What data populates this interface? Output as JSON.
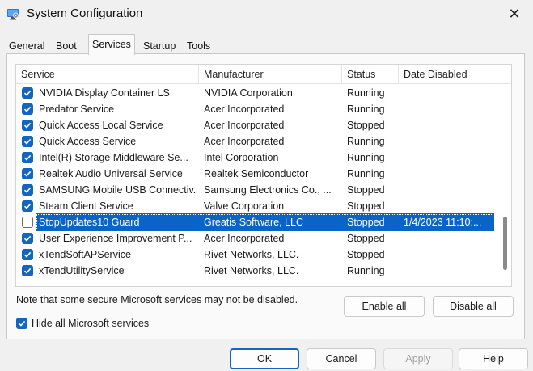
{
  "window": {
    "title": "System Configuration",
    "close_glyph": "✕"
  },
  "tabs": [
    {
      "label": "General"
    },
    {
      "label": "Boot"
    },
    {
      "label": "Services",
      "active": true
    },
    {
      "label": "Startup"
    },
    {
      "label": "Tools"
    }
  ],
  "services_list": {
    "columns": [
      "Service",
      "Manufacturer",
      "Status",
      "Date Disabled"
    ],
    "rows": [
      {
        "checked": true,
        "service": "NVIDIA Display Container LS",
        "manufacturer": "NVIDIA Corporation",
        "status": "Running",
        "date_disabled": ""
      },
      {
        "checked": true,
        "service": "Predator Service",
        "manufacturer": "Acer Incorporated",
        "status": "Running",
        "date_disabled": ""
      },
      {
        "checked": true,
        "service": "Quick Access Local Service",
        "manufacturer": "Acer Incorporated",
        "status": "Stopped",
        "date_disabled": ""
      },
      {
        "checked": true,
        "service": "Quick Access Service",
        "manufacturer": "Acer Incorporated",
        "status": "Running",
        "date_disabled": ""
      },
      {
        "checked": true,
        "service": "Intel(R) Storage Middleware Se...",
        "manufacturer": "Intel Corporation",
        "status": "Running",
        "date_disabled": ""
      },
      {
        "checked": true,
        "service": "Realtek Audio Universal Service",
        "manufacturer": "Realtek Semiconductor",
        "status": "Running",
        "date_disabled": ""
      },
      {
        "checked": true,
        "service": "SAMSUNG Mobile USB Connectiv...",
        "manufacturer": "Samsung Electronics Co., ...",
        "status": "Stopped",
        "date_disabled": ""
      },
      {
        "checked": true,
        "service": "Steam Client Service",
        "manufacturer": "Valve Corporation",
        "status": "Stopped",
        "date_disabled": ""
      },
      {
        "checked": false,
        "selected": true,
        "service": "StopUpdates10 Guard",
        "manufacturer": "Greatis Software, LLC",
        "status": "Stopped",
        "date_disabled": "1/4/2023 11:10:..."
      },
      {
        "checked": true,
        "service": "User Experience Improvement P...",
        "manufacturer": "Acer Incorporated",
        "status": "Stopped",
        "date_disabled": ""
      },
      {
        "checked": true,
        "service": "xTendSoftAPService",
        "manufacturer": "Rivet Networks, LLC.",
        "status": "Stopped",
        "date_disabled": ""
      },
      {
        "checked": true,
        "service": "xTendUtilityService",
        "manufacturer": "Rivet Networks, LLC.",
        "status": "Running",
        "date_disabled": ""
      }
    ]
  },
  "note": "Note that some secure Microsoft services may not be disabled.",
  "buttons": {
    "enable_all": "Enable all",
    "disable_all": "Disable all",
    "ok": "OK",
    "cancel": "Cancel",
    "apply": "Apply",
    "help": "Help"
  },
  "hide_ms": {
    "label": "Hide all Microsoft services",
    "checked": true
  },
  "colors": {
    "accent": "#1565c0",
    "selection": "#0a64c8"
  }
}
